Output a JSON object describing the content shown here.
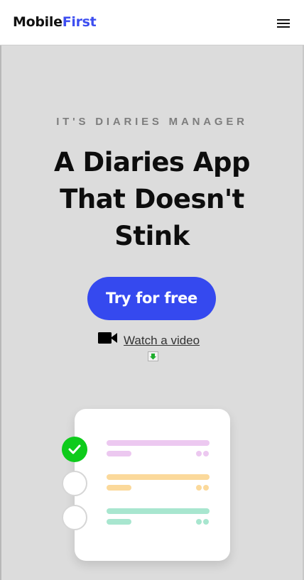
{
  "header": {
    "logo_part1": "Mobile",
    "logo_part2": "First",
    "menu_icon": "hamburger-menu-icon"
  },
  "hero": {
    "eyebrow": "IT'S DIARIES MANAGER",
    "headline_line1": "A Diaries App",
    "headline_line2": "That Doesn't",
    "headline_line3": "Stink",
    "cta_label": "Try for free",
    "video_label": "Watch a video",
    "video_icon": "video-camera-icon",
    "download_icon": "download-arrow-icon"
  },
  "checklist": {
    "items": [
      {
        "checked": true,
        "color": "#ecc8f0"
      },
      {
        "checked": false,
        "color": "#fbd99b"
      },
      {
        "checked": false,
        "color": "#a8e6cf"
      }
    ]
  },
  "colors": {
    "accent": "#3549ef",
    "check_green": "#0ecb1b",
    "page_bg": "#dcdcdc"
  }
}
